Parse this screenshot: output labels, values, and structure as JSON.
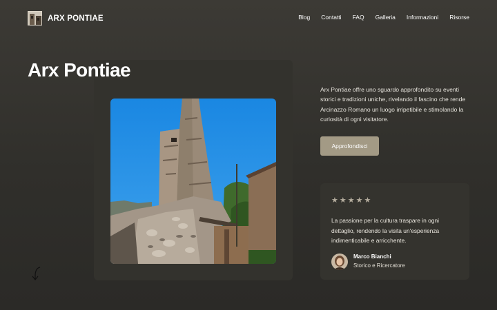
{
  "header": {
    "brand": "ARX PONTIAE",
    "nav": [
      "Blog",
      "Contatti",
      "FAQ",
      "Galleria",
      "Informazioni",
      "Risorse"
    ]
  },
  "hero": {
    "title": "Arx Pontiae",
    "description": "Arx Pontiae offre uno sguardo approfondito su eventi storici e tradizioni uniche, rivelando il fascino che rende Arcinazzo Romano un luogo irripetibile e stimolando la curiosità di ogni visitatore.",
    "cta_label": "Approfondisci"
  },
  "testimonial": {
    "rating": 5,
    "quote": "La passione per la cultura traspare in ogni dettaglio, rendendo la visita un'esperienza indimenticabile e arricchente.",
    "author_name": "Marco Bianchi",
    "author_role": "Storico e Ricercatore"
  },
  "icons": {
    "star": "star-icon",
    "arrow": "curved-arrow-icon"
  },
  "colors": {
    "accent_button": "#a39a85",
    "card_background": "#34332e",
    "star": "#b5ad9e",
    "sky": "#1f8fe6"
  }
}
